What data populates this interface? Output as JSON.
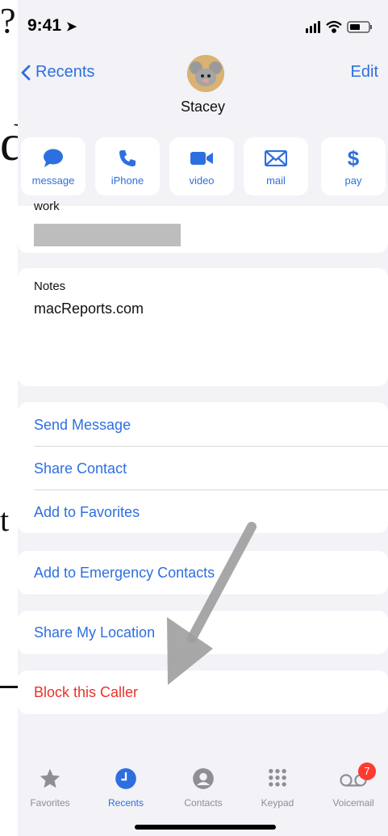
{
  "status": {
    "time": "9:41"
  },
  "nav": {
    "back_label": "Recents",
    "edit_label": "Edit",
    "contact_name": "Stacey"
  },
  "actions": [
    {
      "label": "message",
      "icon": "message-bubble-icon"
    },
    {
      "label": "iPhone",
      "icon": "phone-icon"
    },
    {
      "label": "video",
      "icon": "video-camera-icon"
    },
    {
      "label": "mail",
      "icon": "mail-envelope-icon"
    },
    {
      "label": "pay",
      "icon": "dollar-icon"
    }
  ],
  "details": {
    "work_label": "work"
  },
  "notes": {
    "label": "Notes",
    "value": "macReports.com"
  },
  "options": {
    "send_message": "Send Message",
    "share_contact": "Share Contact",
    "add_favorites": "Add to Favorites",
    "add_emergency": "Add to Emergency Contacts",
    "share_location": "Share My Location",
    "block_caller": "Block this Caller"
  },
  "tabs": [
    {
      "label": "Favorites",
      "icon": "star-icon"
    },
    {
      "label": "Recents",
      "icon": "clock-icon"
    },
    {
      "label": "Contacts",
      "icon": "person-circle-icon"
    },
    {
      "label": "Keypad",
      "icon": "keypad-icon"
    },
    {
      "label": "Voicemail",
      "icon": "voicemail-icon",
      "badge": "7"
    }
  ],
  "colors": {
    "accent": "#2e6fe0",
    "destructive": "#e8332b",
    "background": "#f2f2f7",
    "badge": "#ff3b30"
  }
}
